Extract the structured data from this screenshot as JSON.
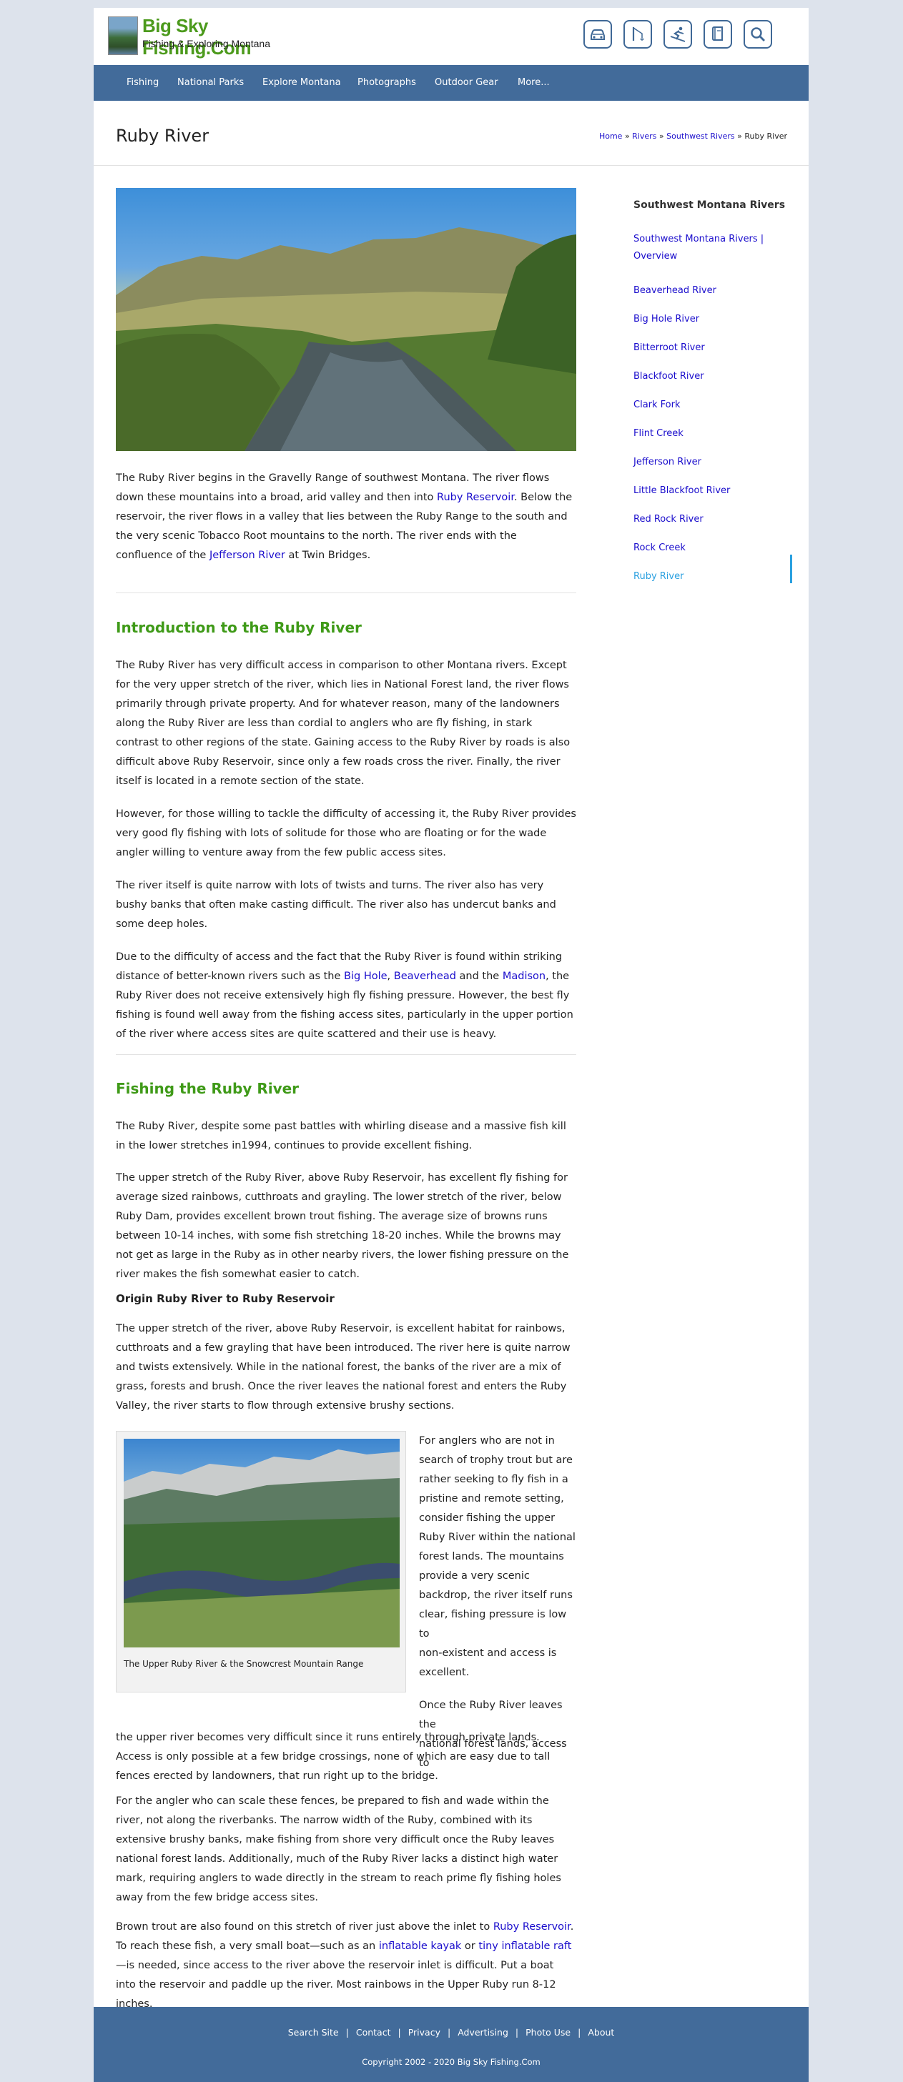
{
  "site": {
    "title": "Big Sky Fishing.Com",
    "subtitle": "Fishing & Exploring Montana"
  },
  "header_icons": [
    "car-icon",
    "fishing-rod-icon",
    "skier-icon",
    "book-icon",
    "search-icon"
  ],
  "nav": [
    "Fishing",
    "National Parks",
    "Explore Montana",
    "Photographs",
    "Outdoor Gear",
    "More..."
  ],
  "page": {
    "title": "Ruby River",
    "breadcrumb": [
      "Home",
      "Rivers",
      "Southwest Rivers",
      "Ruby River"
    ],
    "breadcrumb_sep": "»"
  },
  "intro": {
    "p1_a": "The Ruby River begins in the Gravelly Range of southwest Montana. The river flows down these mountains into a broad, arid valley and then into ",
    "p1_link1": "Ruby Reservoir",
    "p1_b": ". Below the reservoir, the river flows in a valley that lies between the Ruby Range to the south and the very scenic Tobacco Root mountains to the north. The river ends with the confluence of the ",
    "p1_link2": "Jefferson River",
    "p1_c": " at Twin Bridges."
  },
  "section1": {
    "heading": "Introduction to the Ruby River",
    "p1": "The Ruby River has very difficult access in comparison to other Montana rivers. Except for the very upper stretch of the river, which lies in National Forest land, the river flows primarily through private property. And for whatever reason, many of the landowners along the Ruby River are less than cordial to anglers who are fly fishing, in stark contrast to other regions of the state. Gaining access to the Ruby River by roads is also difficult above Ruby Reservoir, since only a few roads cross the river. Finally, the river itself is located in a remote section of the state.",
    "p2": "However, for those willing to tackle the difficulty of accessing it, the Ruby River provides very good fly fishing with lots of solitude for those who are floating or for the wade angler willing to venture away from the few public access sites.",
    "p3": "The river itself is quite narrow with lots of twists and turns. The river also has very bushy banks that often make casting difficult. The river also has undercut banks and some deep holes.",
    "p4_a": "Due to the difficulty of access and the fact that the Ruby River is found within striking distance of better-known rivers such as the ",
    "p4_link1": "Big Hole",
    "p4_sep": ", ",
    "p4_link2": "Beaverhead",
    "p4_and": " and the ",
    "p4_link3": "Madison",
    "p4_b": ", the Ruby River does not receive extensively high fly fishing pressure. However, the best fly fishing is found well away from the fishing access sites, particularly in the upper portion of the river where access sites are quite scattered and their use is heavy."
  },
  "section2": {
    "heading": "Fishing the Ruby River",
    "p1": "The Ruby River, despite some past battles with whirling disease and a massive fish kill in the lower stretches in1994, continues to provide excellent fishing.",
    "p2": "The upper stretch of the Ruby River, above Ruby Reservoir, has excellent fly fishing for average sized rainbows, cutthroats and grayling. The lower stretch of the river, below Ruby Dam, provides excellent brown trout fishing. The average size of browns runs between 10-14 inches, with some fish stretching 18-20 inches. While the browns may not get as large in the Ruby as in other nearby rivers, the lower fishing pressure on the river makes the fish somewhat easier to catch.",
    "subheading": "Origin Ruby River to Ruby Reservoir",
    "p3": "The upper stretch of the river, above Ruby Reservoir, is excellent habitat for rainbows, cutthroats and a few grayling that have been introduced. The river here is quite narrow and twists extensively. While in the national forest, the banks of the river are a mix of grass, forests and brush. Once the river leaves the national forest and enters the Ruby Valley, the river starts to flow through extensive brushy sections.",
    "figure_caption": "The Upper Ruby River & the Snowcrest Mountain Range",
    "wrap_lines": [
      "For anglers who are not in",
      "search of trophy trout but are",
      "rather seeking to fly fish in a",
      "pristine and remote setting,",
      "consider fishing the upper",
      "Ruby River within the national",
      "forest lands. The mountains",
      "provide a very scenic",
      "backdrop, the river itself runs",
      "clear, fishing pressure is low to",
      "non-existent and access is",
      "excellent.",
      "",
      "Once the Ruby River leaves the",
      "national forest lands, access to"
    ],
    "p4_rest": "the upper river becomes very difficult since it runs entirely through private lands. Access is only possible at a few bridge crossings, none of which are easy due to tall fences erected by landowners, that run right up to the bridge.",
    "p5": "For the angler who can scale these fences, be prepared to fish and wade within the river, not along the riverbanks. The narrow width of the Ruby, combined with its extensive brushy banks, make fishing from shore very difficult once the Ruby leaves national forest lands. Additionally, much of the Ruby River lacks a distinct high water mark, requiring anglers to wade directly in the stream to reach prime fly fishing holes away from the few bridge access sites.",
    "p6_a": "Brown trout are also found on this stretch of river just above the inlet to ",
    "p6_link1": "Ruby Reservoir",
    "p6_b": ". To reach these fish, a very small boat—such as an ",
    "p6_link2": "inflatable kayak",
    "p6_or": " or ",
    "p6_link3": "tiny inflatable raft",
    "p6_c": "—is needed, since access to the river above the reservoir inlet is difficult. Put a boat into the reservoir and paddle up the river. Most rainbows in the Upper Ruby run 8-12 inches."
  },
  "sidebar": {
    "title": "Southwest Montana Rivers",
    "items": [
      "Southwest Montana Rivers | Overview",
      "Beaverhead River",
      "Big Hole River",
      "Bitterroot River",
      "Blackfoot River",
      "Clark Fork",
      "Flint Creek",
      "Jefferson River",
      "Little Blackfoot River",
      "Red Rock River",
      "Rock Creek",
      "Ruby River"
    ],
    "active_index": 11
  },
  "footer": {
    "links": [
      "Search Site",
      "Contact",
      "Privacy",
      "Advertising",
      "Photo Use",
      "About"
    ],
    "separator": "|",
    "copyright": "Copyright 2002 - 2020 Big Sky Fishing.Com"
  },
  "colors": {
    "nav_bg": "#426b9a",
    "heading_green": "#3f9a18",
    "link_blue": "#1a0dcc",
    "active_blue": "#2aa0e0"
  }
}
